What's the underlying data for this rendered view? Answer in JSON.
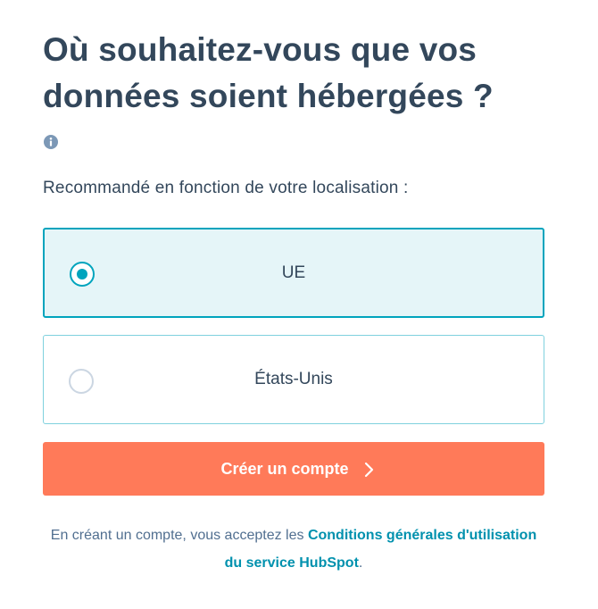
{
  "page": {
    "title": "Où souhaitez-vous que vos données soient hébergées ?",
    "info_icon": "info-icon",
    "subtitle": "Recommandé en fonction de votre localisation :"
  },
  "options": [
    {
      "label": "UE",
      "selected": true
    },
    {
      "label": "États-Unis",
      "selected": false
    }
  ],
  "cta": {
    "label": "Créer un compte",
    "icon": "chevron-right-icon"
  },
  "terms": {
    "prefix": "En créant un compte, vous acceptez les ",
    "link_text": "Conditions générales d'utilisation du service HubSpot",
    "suffix": "."
  },
  "colors": {
    "text": "#33475b",
    "accent": "#00a4bd",
    "selected_bg": "#e5f5f8",
    "cta_bg": "#ff7a59",
    "link": "#0091ae",
    "terms_text": "#516f90"
  }
}
